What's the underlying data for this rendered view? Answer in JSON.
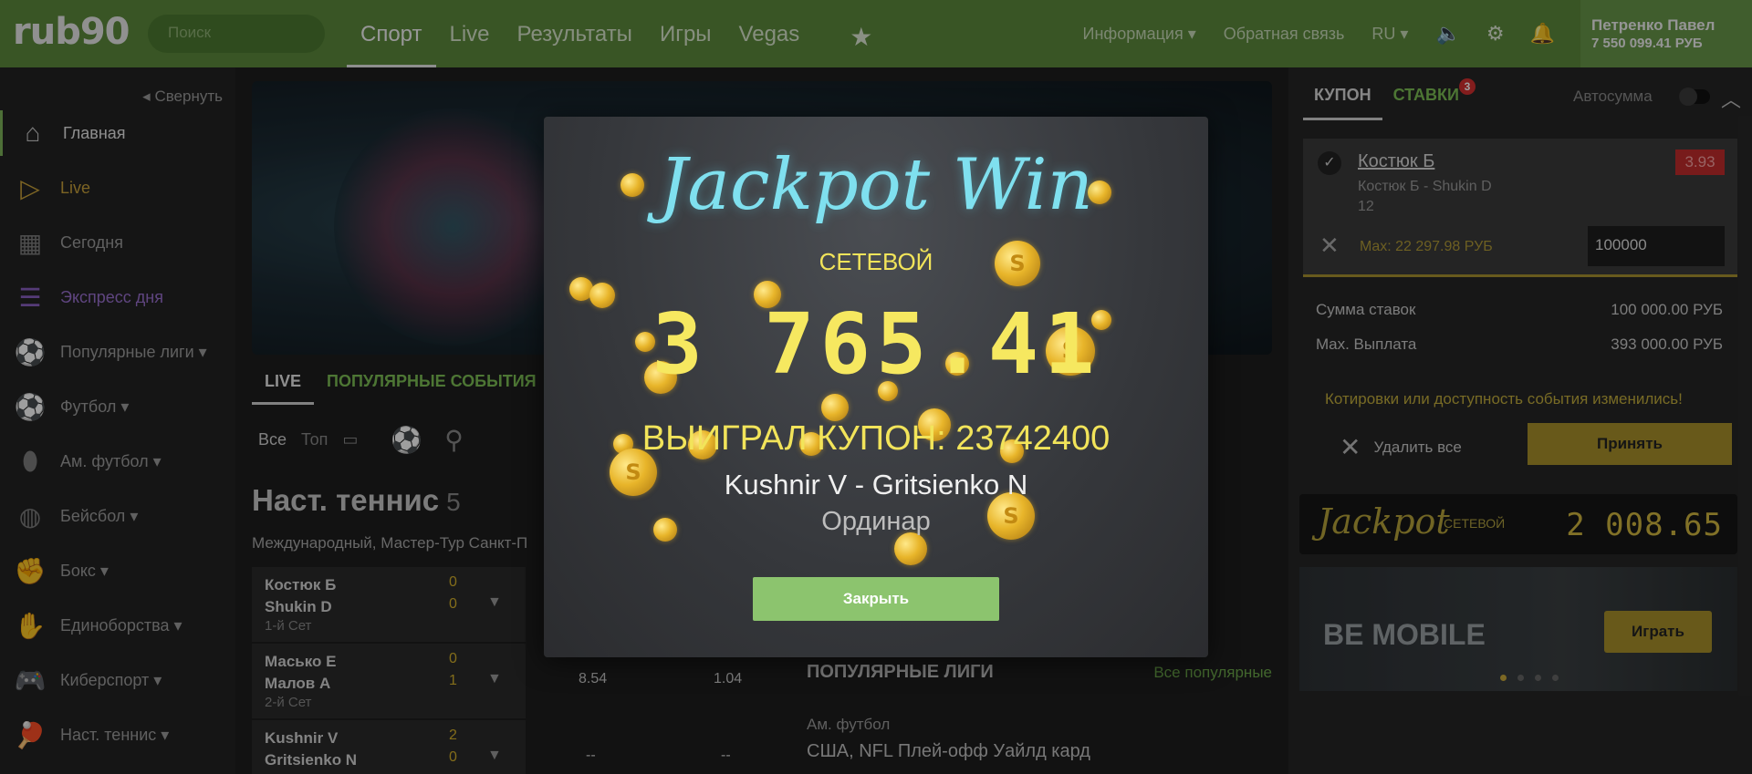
{
  "header": {
    "logo": "rub90",
    "search_placeholder": "Поиск",
    "nav": [
      "Спорт",
      "Live",
      "Результаты",
      "Игры",
      "Vegas"
    ],
    "info": "Информация",
    "feedback": "Обратная связь",
    "lang": "RU",
    "user_name": "Петренко Павел",
    "balance": "7 550 099.41 РУБ"
  },
  "sidebar": {
    "collapse": "Свернуть",
    "items": [
      {
        "label": "Главная",
        "icon": "home-icon"
      },
      {
        "label": "Live",
        "icon": "play-icon"
      },
      {
        "label": "Сегодня",
        "icon": "calendar-icon"
      },
      {
        "label": "Экспресс дня",
        "icon": "list-icon"
      },
      {
        "label": "Популярные лиги",
        "icon": "balls-icon"
      },
      {
        "label": "Футбол",
        "icon": "football-icon"
      },
      {
        "label": "Ам. футбол",
        "icon": "american-football-icon"
      },
      {
        "label": "Бейсбол",
        "icon": "baseball-icon"
      },
      {
        "label": "Бокс",
        "icon": "boxing-icon"
      },
      {
        "label": "Единоборства",
        "icon": "martial-arts-icon"
      },
      {
        "label": "Киберспорт",
        "icon": "gamepad-icon"
      },
      {
        "label": "Наст. теннис",
        "icon": "table-tennis-icon"
      }
    ]
  },
  "main": {
    "tabs": [
      "LIVE",
      "ПОПУЛЯРНЫЕ СОБЫТИЯ"
    ],
    "filter_all": "Все",
    "filter_top": "Топ",
    "sport_title": "Наст. теннис",
    "sport_count": "5",
    "sport_sub": "Международный, Мастер-Тур Санкт-П",
    "matches": [
      {
        "p1": "Костюк Б",
        "p2": "Shukin D",
        "s1": "0",
        "s2": "0",
        "set": "1-й Сет"
      },
      {
        "p1": "Масько Е",
        "p2": "Малов А",
        "s1": "0",
        "s2": "1",
        "set": "2-й Сет"
      },
      {
        "p1": "Kushnir V",
        "p2": "Gritsienko N",
        "s1": "2",
        "s2": "0",
        "set": ""
      }
    ],
    "odds_row2": [
      "8.54",
      "1.04"
    ],
    "odds_row3": [
      "--",
      "--"
    ],
    "popular_leagues": "ПОПУЛЯРНЫЕ ЛИГИ",
    "all_popular": "Все популярные",
    "league_sport": "Ам. футбол",
    "league_name": "США, NFL Плей-офф Уайлд кард"
  },
  "coupon": {
    "tab_coupon": "КУПОН",
    "tab_bets": "СТАВКИ",
    "bets_badge": "3",
    "autosum": "Автосумма",
    "bet_name": "Костюк Б",
    "bet_match": "Костюк Б - Shukin D",
    "bet_sel": "12",
    "odd": "3.93",
    "max": "Max: 22 297.98 РУБ",
    "amount": "100000",
    "sum_label": "Сумма ставок",
    "sum_value": "100 000.00 РУБ",
    "max_payout_label": "Max. Выплата",
    "max_payout_value": "393 000.00 РУБ",
    "warning": "Котировки или доступность события изменились!",
    "delete_all": "Удалить все",
    "accept": "Принять",
    "jackpot_label": "Jackpot",
    "jackpot_net": "СЕТЕВОЙ",
    "jackpot_value": "2 008.65",
    "mobile_title": "BE MOBILE",
    "play": "Играть"
  },
  "modal": {
    "title": "Jackpot Win",
    "network": "СЕТЕВОЙ",
    "amount": "3 765.41",
    "coupon": "ВЫИГРАЛ КУПОН: 23742400",
    "match": "Kushnir V - Gritsienko N",
    "type": "Ординар",
    "close": "Закрыть"
  },
  "colors": {
    "header_green": "#5c8a3c",
    "accent_green": "#7cbf55",
    "gold": "#a8902a",
    "jackpot_cyan": "#7fe0ef",
    "jackpot_yellow": "#f6e860"
  }
}
